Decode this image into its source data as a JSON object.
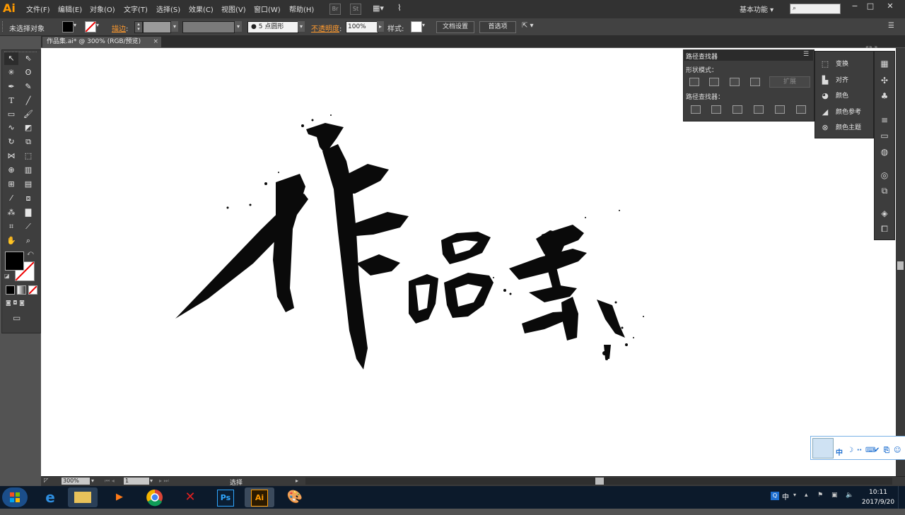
{
  "menubar": {
    "app_logo": "Ai",
    "items": [
      "文件(F)",
      "编辑(E)",
      "对象(O)",
      "文字(T)",
      "选择(S)",
      "效果(C)",
      "视图(V)",
      "窗口(W)",
      "帮助(H)"
    ],
    "bridge_label": "Br",
    "stock_label": "St",
    "workspace": "基本功能",
    "window_controls": [
      "−",
      "□",
      "✕"
    ]
  },
  "control_bar": {
    "selection_status": "未选择对象",
    "stroke_label": "描边",
    "brush_size": "5",
    "brush_type": "点圆形",
    "opacity_label": "不透明度",
    "opacity_value": "100%",
    "style_label": "样式",
    "doc_setup": "文档设置",
    "preferences": "首选项"
  },
  "document_tab": {
    "title": "作品集.ai* @ 300% (RGB/预览)",
    "close": "×"
  },
  "pathfinder_panel": {
    "title": "路径查找器",
    "shape_modes_label": "形状模式：",
    "pathfinders_label": "路径查找器：",
    "expand_label": "扩展"
  },
  "dock_panel": {
    "items": [
      {
        "label": "变换",
        "icon": "transform-icon"
      },
      {
        "label": "对齐",
        "icon": "align-icon"
      },
      {
        "label": "颜色",
        "icon": "color-icon"
      },
      {
        "label": "颜色参考",
        "icon": "color-guide-icon"
      },
      {
        "label": "颜色主题",
        "icon": "color-themes-icon"
      }
    ]
  },
  "artwork": {
    "characters": [
      "作",
      "品",
      "集"
    ],
    "ink_color": "#0a0a0a"
  },
  "ime_bar": {
    "mode": "中"
  },
  "status_bar": {
    "zoom": "300%",
    "page": "1",
    "tool": "选择"
  },
  "taskbar": {
    "apps": [
      "ie",
      "explorer",
      "media",
      "chrome",
      "xmind",
      "Ps",
      "Ai",
      "paint"
    ],
    "ps_label": "Ps",
    "ai_label": "Ai",
    "ime_indicator": "中",
    "time": "10:11",
    "date": "2017/9/20"
  },
  "colors": {
    "accent_orange": "#ff9a00",
    "panel_bg": "#3d3d3d",
    "canvas": "#ffffff",
    "ime_blue": "#1e6fd0"
  }
}
